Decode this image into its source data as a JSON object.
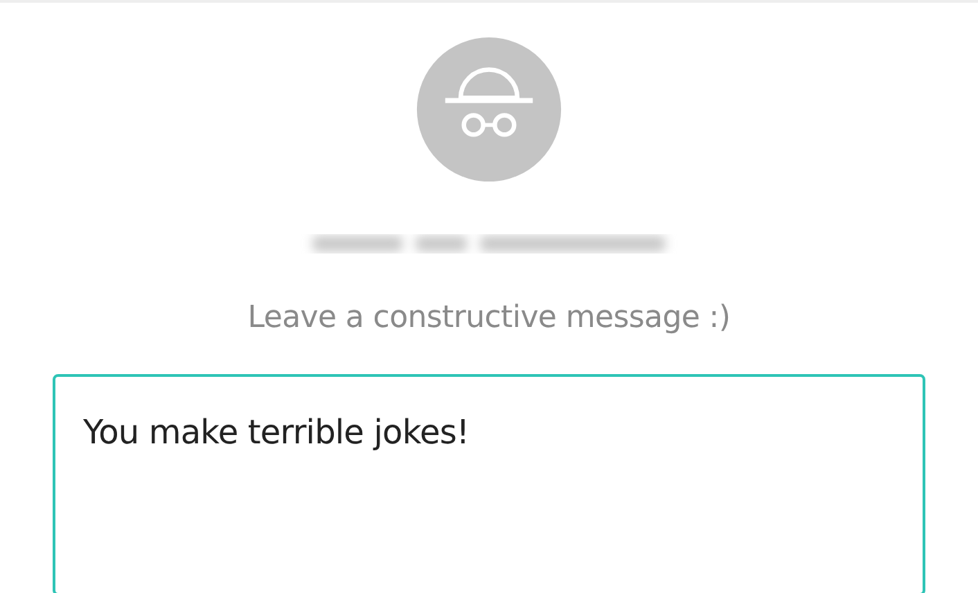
{
  "prompt": "Leave a constructive message :)",
  "message": {
    "value": "You make terrible jokes!"
  }
}
